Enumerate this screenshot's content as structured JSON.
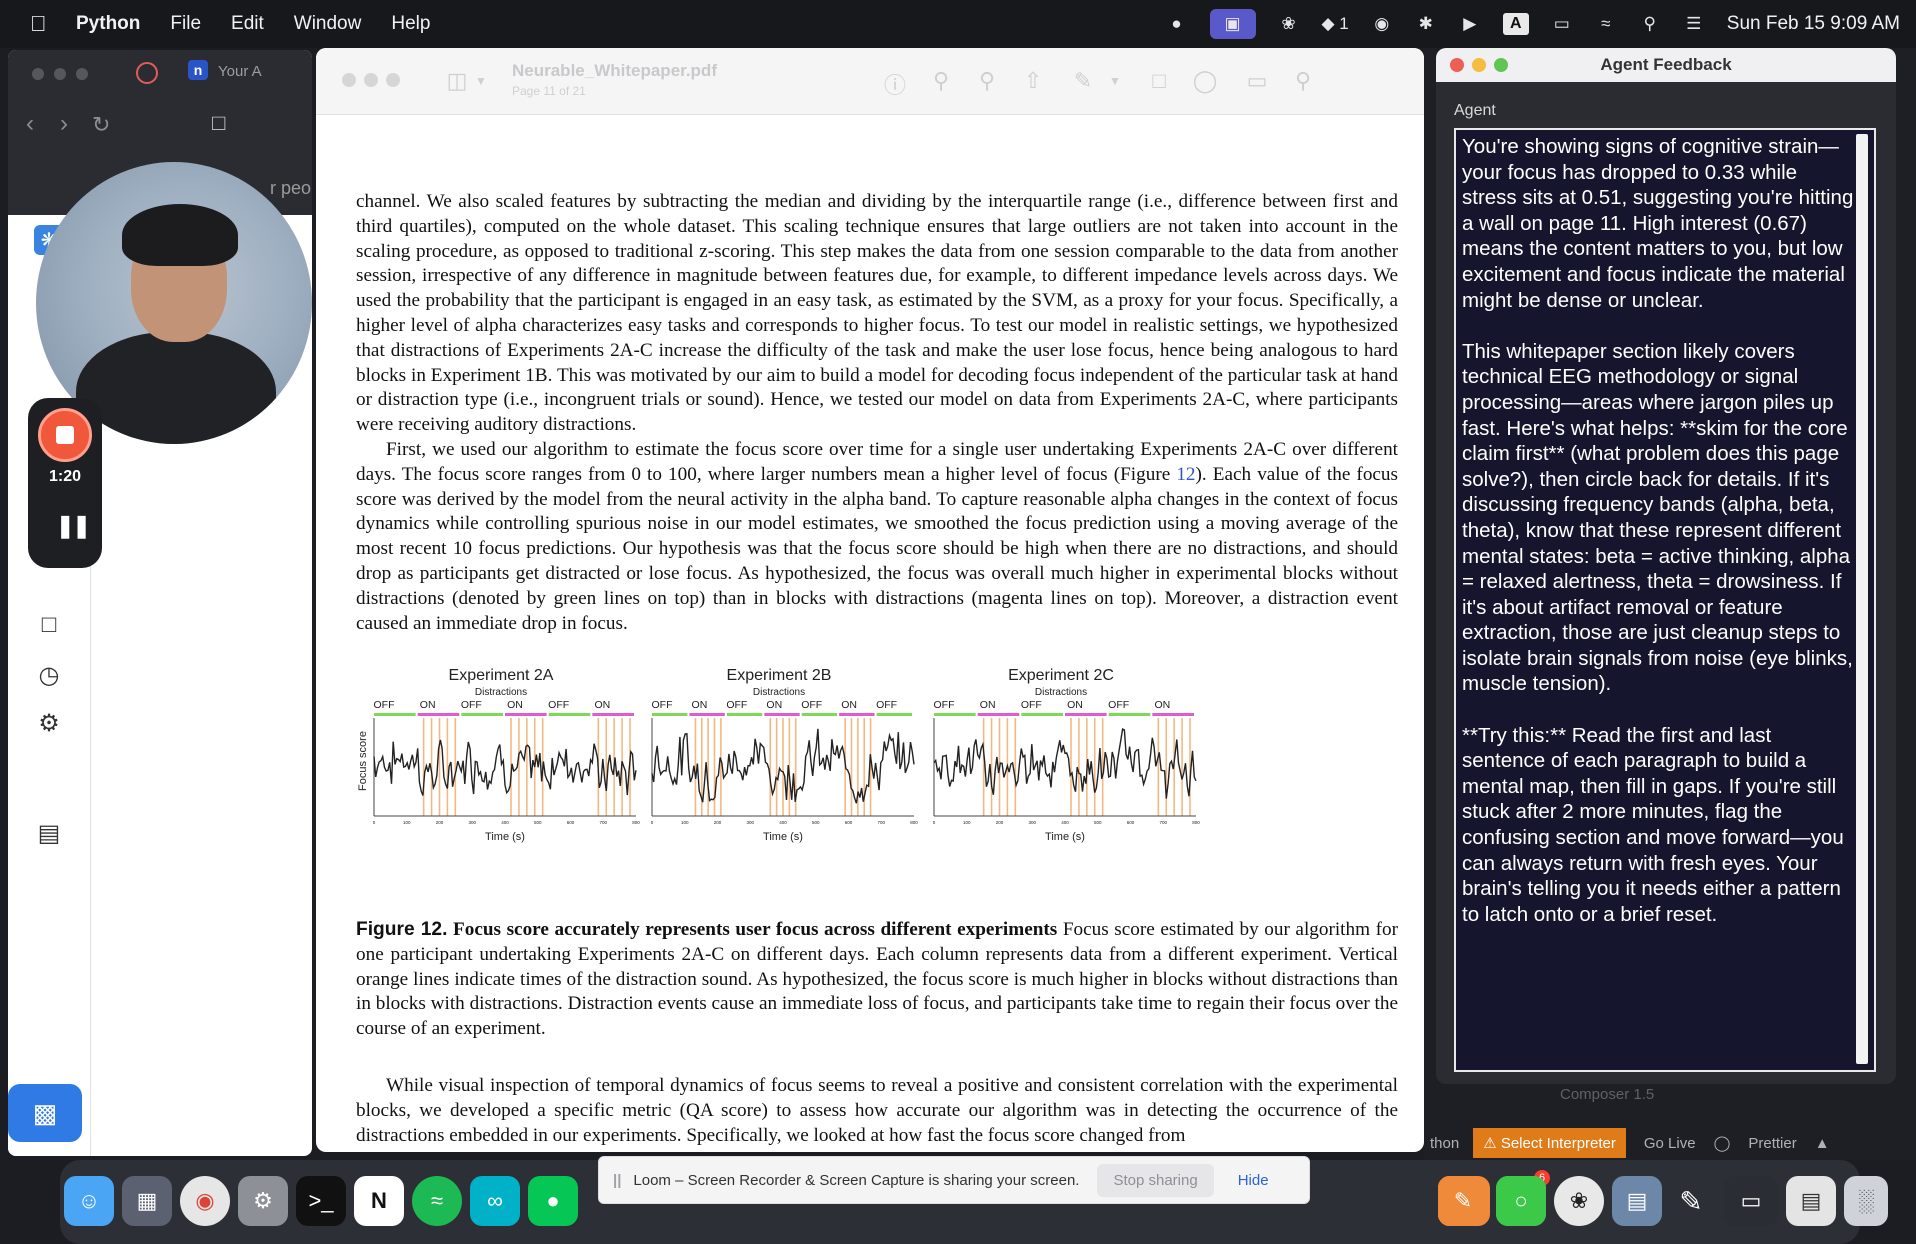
{
  "menubar": {
    "app_name": "Python",
    "menus": [
      "File",
      "Edit",
      "Window",
      "Help"
    ],
    "status_number": "1",
    "keyboard_letter": "A",
    "datetime": "Sun Feb 15  9:09 AM"
  },
  "browser": {
    "tab_label": "Your A",
    "peek_text": "r peo"
  },
  "recorder": {
    "timer": "1:20"
  },
  "pdf": {
    "filename": "Neurable_Whitepaper.pdf",
    "page_info": "Page 11 of 21",
    "para1": "channel. We also scaled features by subtracting the median and dividing by the interquartile range (i.e., difference between first and third quartiles), computed on the whole dataset. This scaling technique ensures that large outliers are not taken into account in the scaling procedure, as opposed to traditional z-scoring. This step makes the data from one session comparable to the data from another session, irrespective of any difference in magnitude between features due, for example, to different impedance levels across days. We used the probability that the participant is engaged in an easy task, as estimated by the SVM, as a proxy for your focus. Specifically, a higher level of alpha characterizes easy tasks and corresponds to higher focus. To test our model in realistic settings, we hypothesized that distractions of Experiments 2A-C increase the difficulty of the task and make the user lose focus, hence being analogous to hard blocks in Experiment 1B. This was motivated by our aim to build a model for decoding focus independent of the particular task at hand or distraction type (i.e., incongruent trials or sound). Hence, we tested our model on data from Experiments 2A-C, where participants were receiving auditory distractions.",
    "para2_a": "First, we used our algorithm to estimate the focus score over time for a single user undertaking Experiments 2A-C over different days. The focus score ranges from 0 to 100, where larger numbers mean a higher level of focus (Figure ",
    "para2_ref": "12",
    "para2_b": "). Each value of the focus score was derived by the model from the neural activity in the alpha band. To capture reasonable alpha changes in the context of focus dynamics while controlling spurious noise in our model estimates, we smoothed the focus prediction using a moving average of the most recent 10 focus predictions. Our hypothesis was that the focus score should be high when there are no distractions, and should drop as participants get distracted or lose focus. As hypothesized, the focus was overall much higher in experimental blocks without distractions (denoted by green lines on top) than in blocks with distractions (magenta lines on top). Moreover, a distraction event caused an immediate drop in focus.",
    "figure": {
      "ylabel": "Focus score",
      "xlabel": "Time (s)",
      "distractions_label": "Distractions",
      "colors": {
        "off": "#7ed957",
        "on": "#e05bd0",
        "event": "#f2a057",
        "line": "#222222"
      },
      "panels": [
        {
          "title": "Experiment 2A",
          "blocks": [
            "OFF",
            "ON",
            "OFF",
            "ON",
            "OFF",
            "ON"
          ],
          "ticks": [
            "0",
            "100",
            "200",
            "300",
            "400",
            "500",
            "600",
            "700",
            "800"
          ]
        },
        {
          "title": "Experiment 2B",
          "blocks": [
            "OFF",
            "ON",
            "OFF",
            "ON",
            "OFF",
            "ON",
            "OFF"
          ],
          "ticks": [
            "0",
            "100",
            "200",
            "300",
            "400",
            "500",
            "600",
            "700",
            "800"
          ]
        },
        {
          "title": "Experiment 2C",
          "blocks": [
            "OFF",
            "ON",
            "OFF",
            "ON",
            "OFF",
            "ON"
          ],
          "ticks": [
            "0",
            "100",
            "200",
            "300",
            "400",
            "500",
            "600",
            "700",
            "800"
          ]
        }
      ]
    },
    "caption_label": "Figure 12.",
    "caption_title": "Focus score accurately represents user focus across different experiments",
    "caption_body": " Focus score estimated by our algorithm for one participant undertaking Experiments 2A-C on different days. Each column represents data from a different experiment. Vertical orange lines indicate times of the distraction sound. As hypothesized, the focus score is much higher in blocks without distractions than in blocks with distractions. Distraction events cause an immediate loss of focus, and participants take time to regain their focus over the course of an experiment.",
    "para3": "While visual inspection of temporal dynamics of focus seems to reveal a positive and consistent correlation with the experimental blocks, we developed a specific metric (QA score) to assess how accurate our algorithm was in detecting the occurrence of the distractions embedded in our experiments. Specifically, we looked at how fast the focus score changed from"
  },
  "agent": {
    "window_title": "Agent Feedback",
    "label": "Agent",
    "message": "You're showing signs of cognitive strain—your focus has dropped to 0.33 while stress sits at 0.51, suggesting you're hitting a wall on page 11. High interest (0.67) means the content matters to you, but low excitement and focus indicate the material might be dense or unclear.\n\nThis whitepaper section likely covers technical EEG methodology or signal processing—areas where jargon piles up fast. Here's what helps: **skim for the core claim first** (what problem does this page solve?), then circle back for details. If it's discussing frequency bands (alpha, beta, theta), know that these represent different mental states: beta = active thinking, alpha = relaxed alertness, theta = drowsiness. If it's about artifact removal or feature extraction, those are just cleanup steps to isolate brain signals from noise (eye blinks, muscle tension).\n\n**Try this:** Read the first and last sentence of each paragraph to build a mental map, then fill in gaps. If you're still stuck after 2 more minutes, flag the confusing section and move forward—you can always return with fresh eyes. Your brain's telling you it needs either a pattern to latch onto or a brief reset."
  },
  "statusbar": {
    "left_text": "thon",
    "select_interpreter": "⚠ Select Interpreter",
    "go_live": "Go Live",
    "prettier": "Prettier",
    "composer": "Composer 1.5"
  },
  "loom": {
    "message": "Loom – Screen Recorder & Screen Capture is sharing your screen.",
    "stop_label": "Stop sharing",
    "hide_label": "Hide"
  },
  "dock": {
    "messages_badge": "6"
  }
}
